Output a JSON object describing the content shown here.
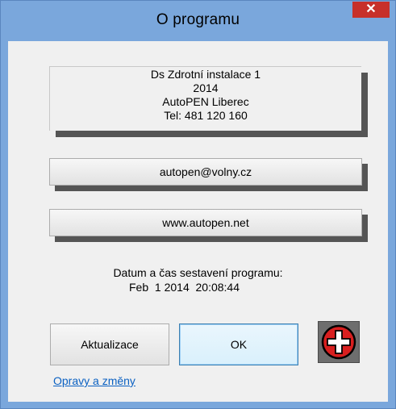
{
  "window": {
    "title": "O programu",
    "close_label": "✕"
  },
  "info": {
    "lines": [
      "Ds Zdrotní instalace 1",
      "2014",
      "AutoPEN Liberec",
      "Tel: 481 120 160"
    ]
  },
  "buttons": {
    "email": "autopen@volny.cz",
    "website": "www.autopen.net",
    "update": "Aktualizace",
    "ok": "OK"
  },
  "build": {
    "label": "Datum a čas sestavení programu:",
    "value": "Feb  1 2014  20:08:44"
  },
  "link": {
    "changes": "Opravy a změny"
  },
  "icons": {
    "app_icon": "red-cross-icon"
  }
}
